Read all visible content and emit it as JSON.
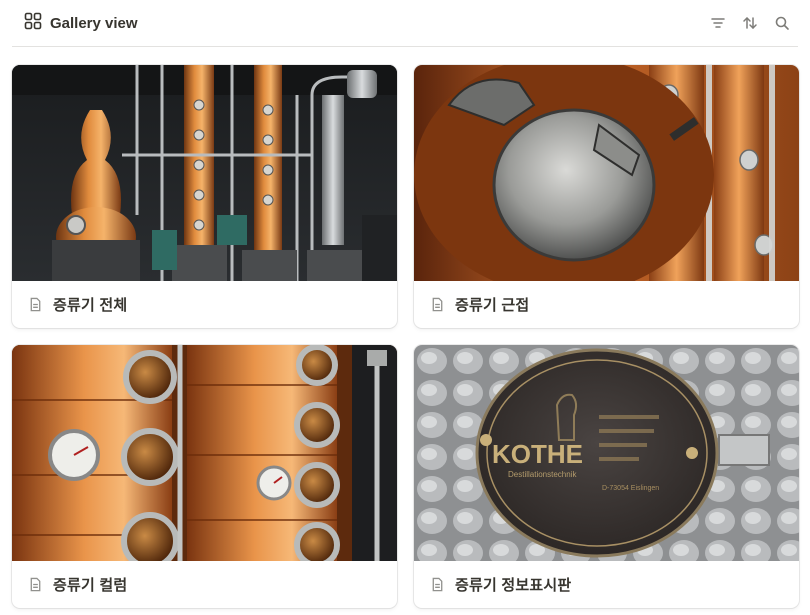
{
  "view": {
    "label": "Gallery view",
    "icon": "gallery-grid-icon"
  },
  "toolbar": {
    "icons": [
      "filter-icon",
      "sort-icon",
      "search-icon"
    ]
  },
  "cards": [
    {
      "title": "증류기 전체",
      "icon": "page-icon",
      "cover": "distillery-overview-photo"
    },
    {
      "title": "증류기 근접",
      "icon": "page-icon",
      "cover": "still-lid-closeup-photo"
    },
    {
      "title": "증류기 컬럼",
      "icon": "page-icon",
      "cover": "copper-column-photo"
    },
    {
      "title": "증류기 정보표시판",
      "icon": "page-icon",
      "cover": "nameplate-photo"
    }
  ],
  "nameplate": {
    "brand": "KOTHE",
    "subtitle": "Destillationstechnik",
    "address": "D-73054 Eislingen"
  }
}
